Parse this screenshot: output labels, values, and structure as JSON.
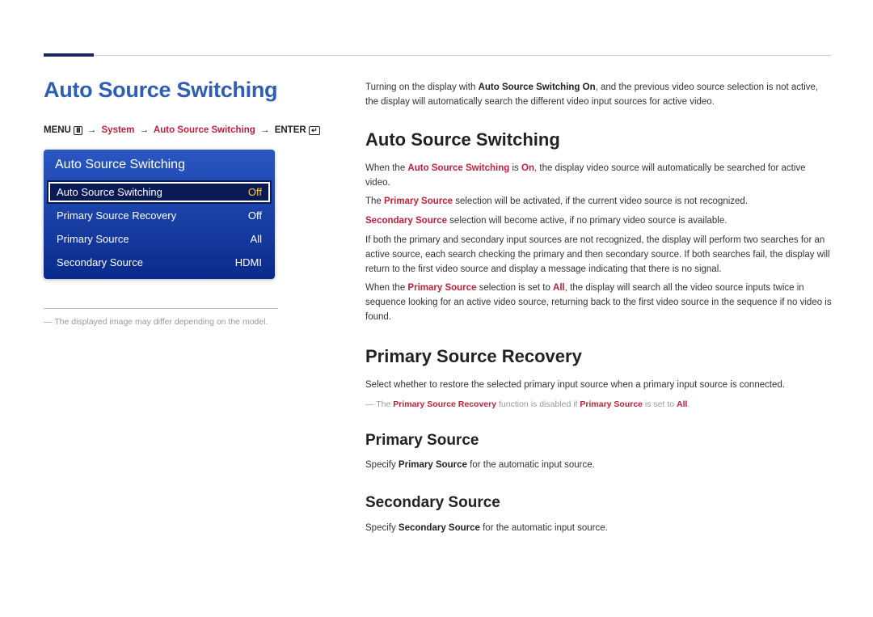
{
  "pageTitle": "Auto Source Switching",
  "breadcrumb": {
    "menu": "MENU",
    "p1": "System",
    "p2": "Auto Source Switching",
    "enter": "ENTER"
  },
  "uiBox": {
    "header": "Auto Source Switching",
    "rows": [
      {
        "label": "Auto Source Switching",
        "value": "Off",
        "selected": true
      },
      {
        "label": "Primary Source Recovery",
        "value": "Off",
        "selected": false
      },
      {
        "label": "Primary Source",
        "value": "All",
        "selected": false
      },
      {
        "label": "Secondary Source",
        "value": "HDMI",
        "selected": false
      }
    ]
  },
  "footnote": "The displayed image may differ depending on the model.",
  "intro": {
    "t1a": "Turning on the display with ",
    "t1b": "Auto Source Switching On",
    "t1c": ", and the previous video source selection is not active, the display will automatically search the different video input sources for active video."
  },
  "sections": {
    "ass": {
      "heading": "Auto Source Switching",
      "p1a": "When the ",
      "p1b": "Auto Source Switching",
      "p1c": " is ",
      "p1d": "On",
      "p1e": ", the display video source will automatically be searched for active video.",
      "p2a": "The ",
      "p2b": "Primary Source",
      "p2c": " selection will be activated, if the current video source is not recognized.",
      "p3a": "Secondary Source",
      "p3b": " selection will become active, if no primary video source is available.",
      "p4": "If both the primary and secondary input sources are not recognized, the display will perform two searches for an active source, each search checking the primary and then secondary source. If both searches fail, the display will return to the first video source and display a message indicating that there is no signal.",
      "p5a": "When the ",
      "p5b": "Primary Source",
      "p5c": " selection is set to ",
      "p5d": "All",
      "p5e": ", the display will search all the video source inputs twice in sequence looking for an active video source, returning back to the first video source in the sequence if no video is found."
    },
    "psr": {
      "heading": "Primary Source Recovery",
      "p1": "Select whether to restore the selected primary input source when a primary input source is connected.",
      "noteA": "The ",
      "noteB": "Primary Source Recovery",
      "noteC": " function is disabled if ",
      "noteD": "Primary Source",
      "noteE": " is set to ",
      "noteF": "All",
      "noteG": "."
    },
    "ps": {
      "heading": "Primary Source",
      "p1a": "Specify ",
      "p1b": "Primary Source",
      "p1c": " for the automatic input source."
    },
    "ss": {
      "heading": "Secondary Source",
      "p1a": "Specify ",
      "p1b": "Secondary Source",
      "p1c": " for the automatic input source."
    }
  }
}
